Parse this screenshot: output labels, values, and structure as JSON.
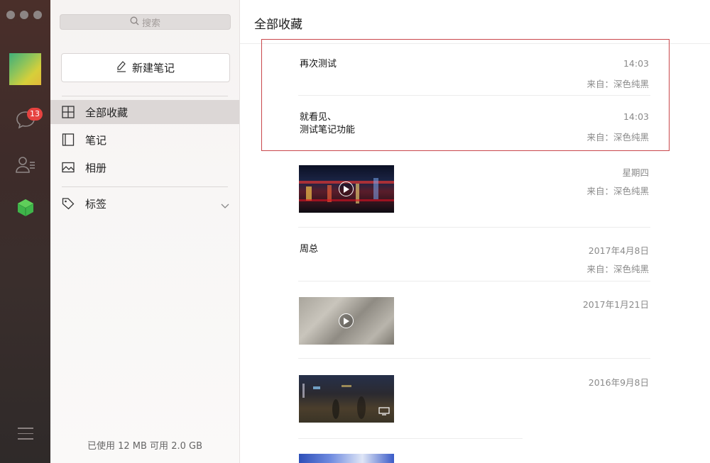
{
  "rail": {
    "unread_badge": "13"
  },
  "sidebar": {
    "search_placeholder": "搜索",
    "new_note_label": "新建笔记",
    "items": [
      {
        "label": "全部收藏",
        "icon": "grid-icon",
        "active": true
      },
      {
        "label": "笔记",
        "icon": "notebook-icon",
        "active": false
      },
      {
        "label": "相册",
        "icon": "image-icon",
        "active": false
      }
    ],
    "tags_label": "标签",
    "storage_text": "已使用 12 MB 可用 2.0 GB"
  },
  "main": {
    "title": "全部收藏",
    "entries": [
      {
        "title": "再次测试",
        "time": "14:03",
        "source": "来自：深色纯黑"
      },
      {
        "title": "就看见、\n测试笔记功能",
        "time": "14:03",
        "source": "来自：深色纯黑"
      },
      {
        "title": "",
        "time": "星期四",
        "source": "来自：深色纯黑",
        "media": "video"
      },
      {
        "title": "周总",
        "time": "2017年4月8日",
        "source": "来自：深色纯黑"
      },
      {
        "title": "",
        "time": "2017年1月21日",
        "source": "",
        "media": "video"
      },
      {
        "title": "",
        "time": "2016年9月8日",
        "source": "",
        "media": "video"
      }
    ]
  },
  "colors": {
    "highlight_border": "#c9474b",
    "badge": "#e64340",
    "active_nav": "#dcd7d6"
  }
}
